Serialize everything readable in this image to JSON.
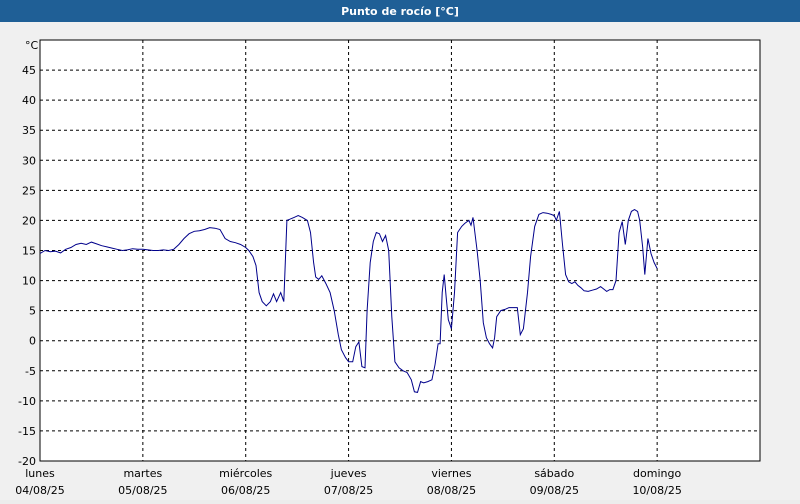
{
  "window": {
    "title": "Punto de rocío [°C]"
  },
  "chart_data": {
    "type": "line",
    "title": "Punto de rocío [°C]",
    "ylabel": "°C",
    "xlabel": "",
    "ylim": [
      -20,
      50
    ],
    "yticks": [
      -20,
      -15,
      -10,
      -5,
      0,
      5,
      10,
      15,
      20,
      25,
      30,
      35,
      40,
      45
    ],
    "xlim": [
      0,
      7
    ],
    "x_unit": "days",
    "days": [
      {
        "day": "lunes",
        "date": "04/08/25"
      },
      {
        "day": "martes",
        "date": "05/08/25"
      },
      {
        "day": "miércoles",
        "date": "06/08/25"
      },
      {
        "day": "jueves",
        "date": "07/08/25"
      },
      {
        "day": "viernes",
        "date": "08/08/25"
      },
      {
        "day": "sábado",
        "date": "09/08/25"
      },
      {
        "day": "domingo",
        "date": "10/08/25"
      }
    ],
    "grid": true,
    "line_color": "#00008b",
    "series": [
      {
        "name": "",
        "points": [
          [
            0.0,
            14.5
          ],
          [
            0.05,
            15.0
          ],
          [
            0.1,
            14.8
          ],
          [
            0.15,
            14.9
          ],
          [
            0.2,
            14.6
          ],
          [
            0.25,
            15.2
          ],
          [
            0.3,
            15.5
          ],
          [
            0.35,
            16.0
          ],
          [
            0.4,
            16.2
          ],
          [
            0.45,
            16.0
          ],
          [
            0.5,
            16.4
          ],
          [
            0.55,
            16.1
          ],
          [
            0.6,
            15.8
          ],
          [
            0.65,
            15.6
          ],
          [
            0.7,
            15.4
          ],
          [
            0.75,
            15.2
          ],
          [
            0.8,
            15.0
          ],
          [
            0.85,
            15.1
          ],
          [
            0.9,
            15.3
          ],
          [
            0.95,
            15.2
          ],
          [
            1.0,
            15.2
          ],
          [
            1.05,
            15.1
          ],
          [
            1.1,
            15.0
          ],
          [
            1.15,
            15.0
          ],
          [
            1.2,
            15.1
          ],
          [
            1.25,
            15.0
          ],
          [
            1.3,
            15.2
          ],
          [
            1.35,
            16.0
          ],
          [
            1.4,
            17.0
          ],
          [
            1.45,
            17.8
          ],
          [
            1.5,
            18.2
          ],
          [
            1.55,
            18.3
          ],
          [
            1.6,
            18.5
          ],
          [
            1.65,
            18.8
          ],
          [
            1.7,
            18.7
          ],
          [
            1.75,
            18.5
          ],
          [
            1.8,
            17.0
          ],
          [
            1.85,
            16.5
          ],
          [
            1.9,
            16.3
          ],
          [
            1.95,
            16.0
          ],
          [
            2.0,
            15.5
          ],
          [
            2.03,
            15.0
          ],
          [
            2.07,
            14.0
          ],
          [
            2.1,
            12.5
          ],
          [
            2.13,
            8.0
          ],
          [
            2.16,
            6.5
          ],
          [
            2.2,
            5.8
          ],
          [
            2.24,
            6.5
          ],
          [
            2.27,
            7.8
          ],
          [
            2.3,
            6.5
          ],
          [
            2.34,
            8.0
          ],
          [
            2.37,
            6.5
          ],
          [
            2.4,
            20.0
          ],
          [
            2.43,
            20.2
          ],
          [
            2.47,
            20.5
          ],
          [
            2.51,
            20.8
          ],
          [
            2.55,
            20.5
          ],
          [
            2.6,
            20.0
          ],
          [
            2.63,
            18.0
          ],
          [
            2.66,
            13.0
          ],
          [
            2.68,
            10.6
          ],
          [
            2.71,
            10.2
          ],
          [
            2.74,
            10.8
          ],
          [
            2.78,
            9.5
          ],
          [
            2.82,
            8.0
          ],
          [
            2.86,
            5.0
          ],
          [
            2.9,
            1.0
          ],
          [
            2.93,
            -1.5
          ],
          [
            2.97,
            -2.8
          ],
          [
            3.0,
            -3.5
          ],
          [
            3.04,
            -3.5
          ],
          [
            3.07,
            -1.0
          ],
          [
            3.1,
            -0.2
          ],
          [
            3.13,
            -4.3
          ],
          [
            3.16,
            -4.5
          ],
          [
            3.18,
            5.0
          ],
          [
            3.21,
            13.0
          ],
          [
            3.24,
            16.5
          ],
          [
            3.27,
            18.0
          ],
          [
            3.3,
            17.8
          ],
          [
            3.33,
            16.5
          ],
          [
            3.36,
            17.5
          ],
          [
            3.39,
            15.0
          ],
          [
            3.42,
            4.0
          ],
          [
            3.45,
            -3.5
          ],
          [
            3.49,
            -4.5
          ],
          [
            3.53,
            -5.0
          ],
          [
            3.57,
            -5.3
          ],
          [
            3.61,
            -6.5
          ],
          [
            3.64,
            -8.5
          ],
          [
            3.67,
            -8.6
          ],
          [
            3.7,
            -6.8
          ],
          [
            3.73,
            -7.0
          ],
          [
            3.77,
            -6.8
          ],
          [
            3.81,
            -6.5
          ],
          [
            3.84,
            -4.0
          ],
          [
            3.87,
            -0.5
          ],
          [
            3.89,
            -0.5
          ],
          [
            3.91,
            8.0
          ],
          [
            3.93,
            11.0
          ],
          [
            3.95,
            7.0
          ],
          [
            3.97,
            3.5
          ],
          [
            4.0,
            2.0
          ],
          [
            4.03,
            8.0
          ],
          [
            4.06,
            18.0
          ],
          [
            4.1,
            19.0
          ],
          [
            4.13,
            19.5
          ],
          [
            4.17,
            20.0
          ],
          [
            4.19,
            19.2
          ],
          [
            4.21,
            20.5
          ],
          [
            4.25,
            15.0
          ],
          [
            4.28,
            10.0
          ],
          [
            4.31,
            3.0
          ],
          [
            4.34,
            0.5
          ],
          [
            4.37,
            -0.5
          ],
          [
            4.4,
            -1.2
          ],
          [
            4.42,
            0.5
          ],
          [
            4.44,
            4.0
          ],
          [
            4.48,
            5.0
          ],
          [
            4.52,
            5.2
          ],
          [
            4.56,
            5.5
          ],
          [
            4.6,
            5.5
          ],
          [
            4.64,
            5.5
          ],
          [
            4.67,
            1.0
          ],
          [
            4.7,
            2.0
          ],
          [
            4.74,
            8.0
          ],
          [
            4.77,
            14.0
          ],
          [
            4.81,
            19.0
          ],
          [
            4.85,
            21.0
          ],
          [
            4.89,
            21.3
          ],
          [
            4.93,
            21.2
          ],
          [
            4.97,
            21.0
          ],
          [
            5.0,
            20.8
          ],
          [
            5.02,
            20.0
          ],
          [
            5.05,
            21.5
          ],
          [
            5.08,
            16.0
          ],
          [
            5.11,
            11.0
          ],
          [
            5.14,
            9.8
          ],
          [
            5.17,
            9.5
          ],
          [
            5.2,
            9.8
          ],
          [
            5.23,
            9.2
          ],
          [
            5.26,
            8.8
          ],
          [
            5.29,
            8.3
          ],
          [
            5.33,
            8.2
          ],
          [
            5.37,
            8.4
          ],
          [
            5.41,
            8.6
          ],
          [
            5.45,
            9.0
          ],
          [
            5.48,
            8.6
          ],
          [
            5.51,
            8.2
          ],
          [
            5.54,
            8.5
          ],
          [
            5.57,
            8.5
          ],
          [
            5.6,
            10.0
          ],
          [
            5.63,
            18.0
          ],
          [
            5.66,
            19.8
          ],
          [
            5.69,
            16.0
          ],
          [
            5.72,
            20.0
          ],
          [
            5.75,
            21.5
          ],
          [
            5.78,
            21.8
          ],
          [
            5.81,
            21.5
          ],
          [
            5.83,
            20.0
          ],
          [
            5.86,
            15.5
          ],
          [
            5.88,
            11.0
          ],
          [
            5.91,
            17.0
          ],
          [
            5.94,
            14.5
          ],
          [
            5.97,
            13.0
          ],
          [
            6.0,
            12.0
          ]
        ]
      }
    ]
  }
}
